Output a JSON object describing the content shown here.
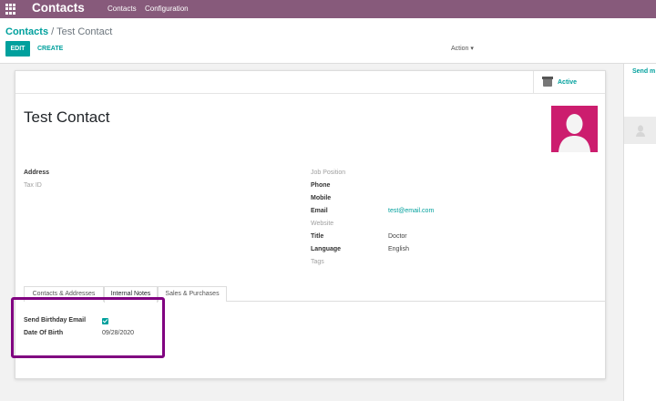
{
  "topbar": {
    "app_name": "Contacts",
    "menu": [
      "Contacts",
      "Configuration"
    ]
  },
  "breadcrumb": {
    "parent": "Contacts",
    "separator": "/",
    "current": "Test Contact"
  },
  "buttons": {
    "edit": "EDIT",
    "create": "CREATE",
    "action": "Action ▾"
  },
  "record": {
    "status": "Active",
    "name": "Test Contact",
    "left_fields": [
      {
        "label": "Address",
        "value": ""
      },
      {
        "label": "Tax ID",
        "value": ""
      }
    ],
    "right_fields": [
      {
        "label": "Job Position",
        "value": ""
      },
      {
        "label": "Phone",
        "value": ""
      },
      {
        "label": "Mobile",
        "value": ""
      },
      {
        "label": "Email",
        "value": "test@email.com"
      },
      {
        "label": "Website",
        "value": ""
      },
      {
        "label": "Title",
        "value": "Doctor"
      },
      {
        "label": "Language",
        "value": "English"
      },
      {
        "label": "Tags",
        "value": ""
      }
    ]
  },
  "tabs": [
    "Contacts & Addresses",
    "Internal Notes",
    "Sales & Purchases"
  ],
  "active_tab": "Internal Notes",
  "tab_fields": {
    "birthday_email_label": "Send Birthday Email",
    "birthday_email_checked": true,
    "dob_label": "Date Of Birth",
    "dob_value": "09/28/2020"
  },
  "chatter": {
    "send_message": "Send m"
  },
  "colors": {
    "brand": "#875a7b",
    "accent": "#00a09d",
    "avatar_bg": "#cc1d6e",
    "highlight": "#800080"
  }
}
